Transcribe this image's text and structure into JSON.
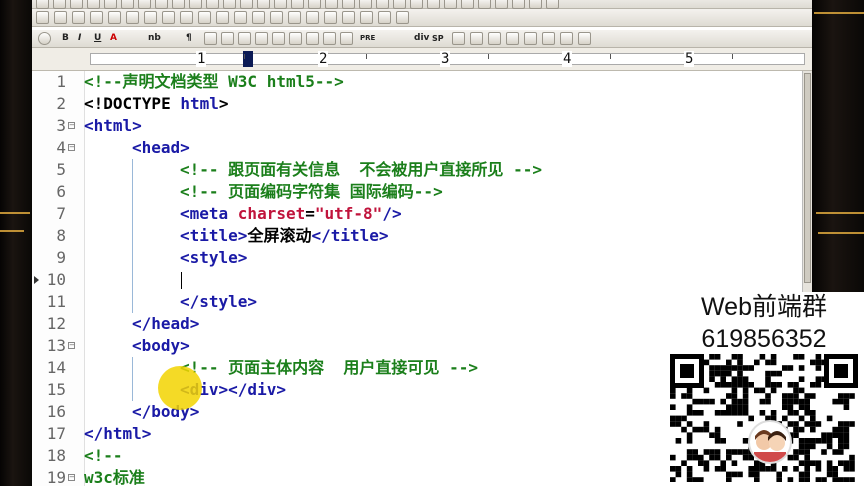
{
  "ruler": {
    "numbers": [
      "1",
      "2",
      "3",
      "4",
      "5"
    ]
  },
  "lines": [
    {
      "num": "1",
      "indent": 0,
      "tokens": [
        {
          "c": "c",
          "t": "<!--声明文档类型 W3C html5-->"
        }
      ]
    },
    {
      "num": "2",
      "indent": 0,
      "tokens": [
        {
          "c": "p",
          "t": "<!DOCTYPE "
        },
        {
          "c": "t",
          "t": "html"
        },
        {
          "c": "p",
          "t": ">"
        }
      ]
    },
    {
      "num": "3",
      "indent": 0,
      "fold": true,
      "tokens": [
        {
          "c": "t",
          "t": "<html>"
        }
      ]
    },
    {
      "num": "4",
      "indent": 1,
      "fold": true,
      "tokens": [
        {
          "c": "t",
          "t": "<head>"
        }
      ]
    },
    {
      "num": "5",
      "indent": 2,
      "tokens": [
        {
          "c": "c",
          "t": "<!-- 跟页面有关信息  不会被用户直接所见 -->"
        }
      ]
    },
    {
      "num": "6",
      "indent": 2,
      "tokens": [
        {
          "c": "c",
          "t": "<!-- 页面编码字符集 国际编码-->"
        }
      ]
    },
    {
      "num": "7",
      "indent": 2,
      "tokens": [
        {
          "c": "t",
          "t": "<meta "
        },
        {
          "c": "a",
          "t": "charset"
        },
        {
          "c": "p",
          "t": "="
        },
        {
          "c": "s",
          "t": "\"utf-8\""
        },
        {
          "c": "t",
          "t": "/>"
        }
      ]
    },
    {
      "num": "8",
      "indent": 2,
      "tokens": [
        {
          "c": "t",
          "t": "<title>"
        },
        {
          "c": "p",
          "t": "全屏滚动"
        },
        {
          "c": "t",
          "t": "</title>"
        }
      ]
    },
    {
      "num": "9",
      "indent": 2,
      "tokens": [
        {
          "c": "t",
          "t": "<style>"
        }
      ]
    },
    {
      "num": "10",
      "indent": 2,
      "mark": true,
      "tokens": []
    },
    {
      "num": "11",
      "indent": 2,
      "tokens": [
        {
          "c": "t",
          "t": "</style>"
        }
      ]
    },
    {
      "num": "12",
      "indent": 1,
      "tokens": [
        {
          "c": "t",
          "t": "</head>"
        }
      ]
    },
    {
      "num": "13",
      "indent": 1,
      "fold": true,
      "tokens": [
        {
          "c": "t",
          "t": "<body>"
        }
      ]
    },
    {
      "num": "14",
      "indent": 2,
      "tokens": [
        {
          "c": "c",
          "t": "<!-- 页面主体内容  用户直接可见 -->"
        }
      ]
    },
    {
      "num": "15",
      "indent": 2,
      "tokens": [
        {
          "c": "t",
          "t": "<div></div>"
        }
      ]
    },
    {
      "num": "16",
      "indent": 1,
      "tokens": [
        {
          "c": "t",
          "t": "</body>"
        }
      ]
    },
    {
      "num": "17",
      "indent": 0,
      "tokens": [
        {
          "c": "t",
          "t": "</html>"
        }
      ]
    },
    {
      "num": "18",
      "indent": 0,
      "tokens": [
        {
          "c": "c",
          "t": "<!--"
        }
      ]
    },
    {
      "num": "19",
      "indent": 0,
      "fold": true,
      "tokens": [
        {
          "c": "c",
          "t": "w3c标准"
        }
      ]
    }
  ],
  "toolbar3_labels": [
    "B",
    "I",
    "U",
    "A",
    "nb",
    "¶",
    "PRE",
    "div",
    "SP"
  ],
  "promo": {
    "title": "Web前端群",
    "number": "619856352"
  }
}
